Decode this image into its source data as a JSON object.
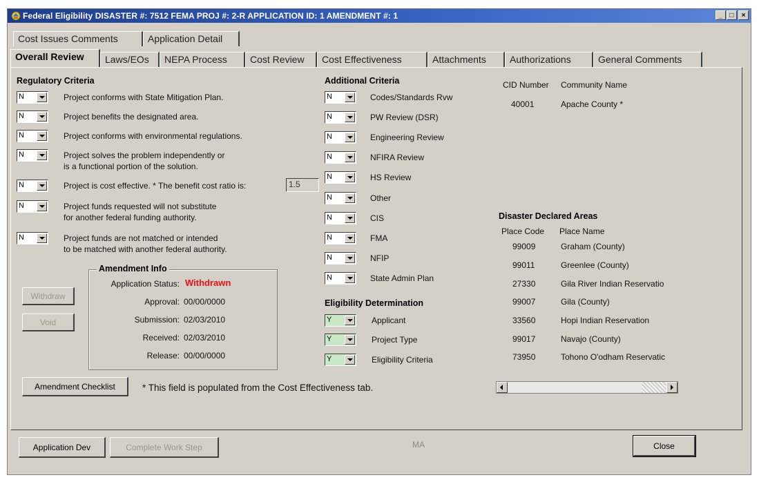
{
  "window": {
    "title": "Federal Eligibility  DISASTER #: 7512   FEMA PROJ #: 2-R   APPLICATION ID: 1   AMENDMENT #: 1",
    "controls": {
      "minimize": "_",
      "maximize": "□",
      "close": "×"
    }
  },
  "upper_tabs": [
    "Cost Issues Comments",
    "Application Detail"
  ],
  "tabs": [
    "Overall Review",
    "Laws/EOs",
    "NEPA Process",
    "Cost Review",
    "Cost Effectiveness",
    "Attachments",
    "Authorizations",
    "General Comments"
  ],
  "regulatory": {
    "header": "Regulatory Criteria",
    "items": [
      {
        "value": "N",
        "line1": "Project conforms with State Mitigation Plan.",
        "line2": ""
      },
      {
        "value": "N",
        "line1": "Project benefits the designated area.",
        "line2": ""
      },
      {
        "value": "N",
        "line1": "Project conforms with environmental regulations.",
        "line2": ""
      },
      {
        "value": "N",
        "line1": "Project solves the problem independently or",
        "line2": "is a functional portion of the solution."
      },
      {
        "value": "N",
        "line1": "Project is cost effective.  * The benefit cost ratio is:",
        "line2": ""
      },
      {
        "value": "N",
        "line1": "Project funds requested will not substitute",
        "line2": "for another federal funding authority."
      },
      {
        "value": "N",
        "line1": "Project funds are not matched or intended",
        "line2": "to be matched with another federal authority."
      }
    ],
    "benefit_cost_ratio": "1.5"
  },
  "additional": {
    "header": "Additional Criteria",
    "items": [
      {
        "value": "N",
        "label": "Codes/Standards Rvw"
      },
      {
        "value": "N",
        "label": "PW Review (DSR)"
      },
      {
        "value": "N",
        "label": "Engineering Review"
      },
      {
        "value": "N",
        "label": "NFIRA Review"
      },
      {
        "value": "N",
        "label": "HS Review"
      },
      {
        "value": "N",
        "label": "Other"
      },
      {
        "value": "N",
        "label": "CIS"
      },
      {
        "value": "N",
        "label": "FMA"
      },
      {
        "value": "N",
        "label": "NFIP"
      },
      {
        "value": "N",
        "label": "State Admin Plan"
      }
    ]
  },
  "eligibility": {
    "header": "Eligibility Determination",
    "items": [
      {
        "value": "Y",
        "label": "Applicant"
      },
      {
        "value": "Y",
        "label": "Project Type"
      },
      {
        "value": "Y",
        "label": "Eligibility Criteria"
      }
    ],
    "highlight_color": "#c8e8c8"
  },
  "community": {
    "col1": "CID Number",
    "col2": "Community Name",
    "rows": [
      {
        "cid": "40001",
        "name": "Apache County *"
      }
    ]
  },
  "declared": {
    "header": "Disaster Declared Areas",
    "col1": "Place Code",
    "col2": "Place Name",
    "rows": [
      {
        "code": "99009",
        "name": "Graham (County)"
      },
      {
        "code": "99011",
        "name": "Greenlee (County)"
      },
      {
        "code": "27330",
        "name": "Gila River Indian Reservatio"
      },
      {
        "code": "99007",
        "name": "Gila (County)"
      },
      {
        "code": "33560",
        "name": "Hopi Indian Reservation"
      },
      {
        "code": "99017",
        "name": "Navajo (County)"
      },
      {
        "code": "73950",
        "name": "Tohono O'odham Reservatic"
      }
    ]
  },
  "amendment": {
    "title": "Amendment Info",
    "status_label": "Application Status:",
    "status_value": "Withdrawn",
    "approval_label": "Approval:",
    "approval_value": "00/00/0000",
    "submission_label": "Submission:",
    "submission_value": "02/03/2010",
    "received_label": "Received:",
    "received_value": "02/03/2010",
    "release_label": "Release:",
    "release_value": "00/00/0000",
    "status_color": "#e8101a"
  },
  "buttons": {
    "withdraw": "Withdraw",
    "void": "Void",
    "amendment_checklist": "Amendment Checklist",
    "application_dev": "Application Dev",
    "complete_work_step": "Complete Work Step",
    "close": "Close"
  },
  "note": "* This field is populated from the Cost Effectiveness tab.",
  "status_text": "MA"
}
